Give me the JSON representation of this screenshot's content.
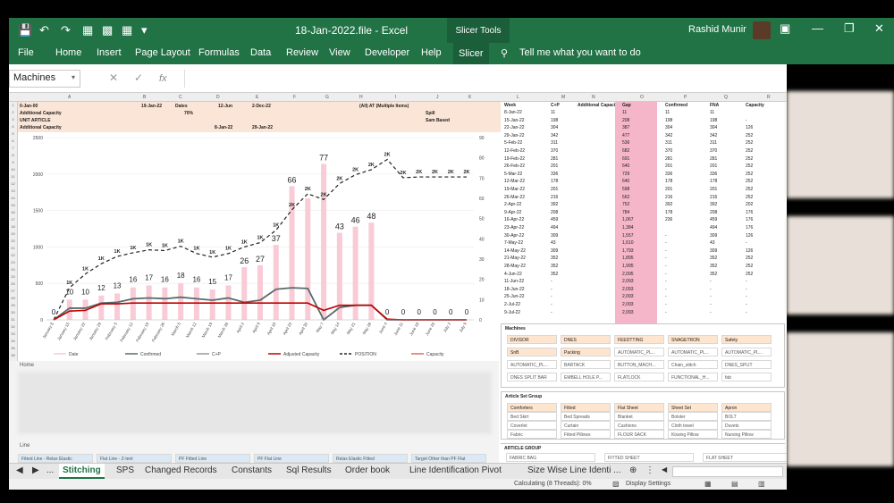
{
  "window": {
    "title": "18-Jan-2022.file  -  Excel",
    "context_tab": "Slicer Tools",
    "user": "Rashid Munir"
  },
  "ribbon_tabs": [
    "File",
    "Home",
    "Insert",
    "Page Layout",
    "Formulas",
    "Data",
    "Review",
    "View",
    "Developer",
    "Help",
    "Slicer"
  ],
  "tell_me": "Tell me what you want to do",
  "namebox": "Machines",
  "column_headers": [
    "A",
    "B",
    "C",
    "D",
    "E",
    "F",
    "G",
    "H",
    "I",
    "J",
    "K",
    "L",
    "M",
    "N",
    "O",
    "P",
    "Q",
    "R"
  ],
  "header_band": {
    "row1": [
      "0-Jan-00",
      "19-Jan-22",
      "Dates",
      "12-Jun",
      "2-Dec-22",
      "(All) AT (Multiple Items)"
    ],
    "row2": [
      "Additional Capacity",
      "70%",
      "Spill"
    ],
    "row3": [
      "UNIT ARTICLE",
      "Sam Based"
    ],
    "row4": [
      "Additional Capacity",
      "8-Jan-22",
      "29-Jan-22"
    ]
  },
  "chart_data": {
    "type": "line",
    "x": [
      "January 8",
      "January 15",
      "January 22",
      "January 29",
      "February 5",
      "February 12",
      "February 19",
      "February 26",
      "March 5",
      "March 12",
      "March 19",
      "March 26",
      "April 2",
      "April 9",
      "April 16",
      "April 23",
      "April 30",
      "May 7",
      "May 14",
      "May 21",
      "May 28",
      "June 4",
      "June 11",
      "June 18",
      "June 25",
      "July 2",
      "July 9"
    ],
    "y_left": [
      0,
      500,
      1000,
      1500,
      2000,
      2500
    ],
    "y_right": [
      0,
      10,
      20,
      30,
      40,
      50,
      60,
      70,
      80,
      90
    ],
    "bar_labels": [
      "0",
      "10",
      "10",
      "12",
      "13",
      "16",
      "17",
      "16",
      "18",
      "16",
      "15",
      "17",
      "26",
      "27",
      "37",
      "66",
      "",
      "77",
      "43",
      "46",
      "48",
      "0",
      "0",
      "0",
      "0",
      "0",
      "0"
    ],
    "bar_values": [
      0,
      10,
      10,
      12,
      13,
      16,
      17,
      16,
      18,
      16,
      15,
      17,
      26,
      27,
      37,
      66,
      60,
      77,
      43,
      46,
      48,
      0,
      0,
      0,
      0,
      0,
      0
    ],
    "position_labels": [
      "",
      "1K",
      "1K",
      "1K",
      "1K",
      "1K",
      "1K",
      "1K",
      "1K",
      "1K",
      "1K",
      "1K",
      "1K",
      "1K",
      "1K",
      "2K",
      "2K",
      "2K",
      "2K",
      "2K",
      "2K",
      "2K",
      "2K",
      "2K",
      "2K",
      "2K",
      "2K"
    ],
    "series": [
      {
        "name": "Date"
      },
      {
        "name": "Confirmed",
        "values": [
          0,
          160,
          160,
          230,
          240,
          290,
          300,
          290,
          310,
          290,
          270,
          300,
          240,
          270,
          420,
          440,
          430,
          0,
          170,
          200,
          200,
          0,
          0,
          0,
          0,
          0,
          0
        ]
      },
      {
        "name": "C+P"
      },
      {
        "name": "Adjusted Capacity",
        "values": [
          0,
          120,
          130,
          220,
          220,
          230,
          230,
          230,
          230,
          230,
          230,
          230,
          230,
          230,
          230,
          230,
          230,
          130,
          200,
          200,
          200,
          10,
          0,
          0,
          0,
          0,
          0
        ]
      },
      {
        "name": "POSITION",
        "values": [
          0,
          440,
          630,
          770,
          870,
          920,
          960,
          950,
          1010,
          910,
          860,
          910,
          1000,
          1060,
          1230,
          1510,
          1730,
          1650,
          1870,
          1990,
          2060,
          2200,
          1950,
          1960,
          1960,
          1960,
          1960
        ]
      },
      {
        "name": "Capacity"
      }
    ]
  },
  "table": {
    "headers": [
      "Week",
      "C+P",
      "Additional Capaci",
      "Gap",
      "Confirmed",
      "FNA",
      "Capacity"
    ],
    "rows": [
      [
        "8-Jan-22",
        "11",
        "",
        "11",
        "11",
        "11",
        ""
      ],
      [
        "15-Jan-22",
        "198",
        "",
        "208",
        "198",
        "198",
        "-"
      ],
      [
        "22-Jan-22",
        "304",
        "",
        "387",
        "304",
        "304",
        "126"
      ],
      [
        "29-Jan-22",
        "342",
        "",
        "477",
        "342",
        "342",
        "252"
      ],
      [
        "5-Feb-22",
        "311",
        "",
        "536",
        "311",
        "311",
        "252"
      ],
      [
        "12-Feb-22",
        "370",
        "",
        "682",
        "370",
        "370",
        "252"
      ],
      [
        "19-Feb-22",
        "281",
        "",
        "691",
        "281",
        "281",
        "252"
      ],
      [
        "26-Feb-22",
        "201",
        "",
        "640",
        "201",
        "201",
        "252"
      ],
      [
        "5-Mar-22",
        "336",
        "",
        "729",
        "336",
        "336",
        "252"
      ],
      [
        "12-Mar-22",
        "178",
        "",
        "640",
        "178",
        "178",
        "252"
      ],
      [
        "19-Mar-22",
        "201",
        "",
        "598",
        "201",
        "201",
        "252"
      ],
      [
        "26-Mar-22",
        "216",
        "",
        "562",
        "216",
        "216",
        "252"
      ],
      [
        "2-Apr-22",
        "392",
        "",
        "752",
        "392",
        "392",
        "202"
      ],
      [
        "9-Apr-22",
        "208",
        "",
        "784",
        "178",
        "208",
        "176"
      ],
      [
        "16-Apr-22",
        "459",
        "",
        "1,067",
        "236",
        "459",
        "176"
      ],
      [
        "23-Apr-22",
        "494",
        "",
        "1,384",
        "",
        "494",
        "176"
      ],
      [
        "30-Apr-22",
        "309",
        "",
        "1,557",
        "-",
        "309",
        "126"
      ],
      [
        "7-May-22",
        "43",
        "",
        "1,610",
        "-",
        "43",
        "-"
      ],
      [
        "14-May-22",
        "309",
        "",
        "1,793",
        "-",
        "309",
        "126"
      ],
      [
        "21-May-22",
        "352",
        "",
        "1,895",
        "-",
        "352",
        "252"
      ],
      [
        "28-May-22",
        "352",
        "",
        "1,995",
        "-",
        "352",
        "252"
      ],
      [
        "4-Jun-22",
        "352",
        "",
        "2,095",
        "-",
        "352",
        "252"
      ],
      [
        "11-Jun-22",
        "-",
        "",
        "2,093",
        "-",
        "-",
        "-"
      ],
      [
        "18-Jun-22",
        "-",
        "",
        "2,093",
        "-",
        "-",
        "-"
      ],
      [
        "25-Jun-22",
        "-",
        "",
        "2,093",
        "-",
        "-",
        "-"
      ],
      [
        "2-Jul-22",
        "-",
        "",
        "2,093",
        "-",
        "-",
        "-"
      ],
      [
        "9-Jul-22",
        "-",
        "",
        "2,093",
        "-",
        "-",
        "-"
      ]
    ]
  },
  "slicer_machines": {
    "title": "Machines",
    "items": [
      [
        "DIVISOR",
        "DNES",
        "FEEDTTING",
        "SNAGETRON",
        "Safety"
      ],
      [
        "SnB",
        "Packing",
        "AUTOMATIC_PL...",
        "AUTOMATIC_PL...",
        "AUTOMATIC_PL..."
      ],
      [
        "AUTOMATIC_PL...",
        "BARTACK",
        "BUTTON_MACH...",
        "Chain_stitch",
        "DNES_SPLIT"
      ],
      [
        "DNES SPLIT BAR",
        "EMBELL HOLE P...",
        "FLATLOCK",
        "FUNCTIONAL_H...",
        "fab"
      ]
    ]
  },
  "slicer_article": {
    "title": "Article Set Group",
    "items": [
      [
        "Comforters",
        "Fitted",
        "Flat Sheet",
        "Sheet Set",
        "Apron"
      ],
      [
        "Bed Skirt",
        "Bed Spreads",
        "Blanket",
        "Bolster",
        "BOLT"
      ],
      [
        "Coverlet",
        "Curtain",
        "Cushions",
        "Cloth towel",
        "Duvets"
      ],
      [
        "Fabric",
        "Fitted Pillows",
        "FLOUR SACK",
        "Kissing Pillow",
        "Nursing Pillow"
      ]
    ]
  },
  "article_group": {
    "title": "ARTICLE GROUP",
    "items": [
      "FABRIC BAG",
      "FITTED SHEET",
      "FLAT SHEET"
    ]
  },
  "panels": {
    "home": "Home",
    "line": "Line"
  },
  "line_items": [
    "Fitted Line - Relax Elastic",
    "Flat Line - Z-tent",
    "PF Fitted Line",
    "PF Flat Line",
    "Relax Elastic Fitted",
    "Target Other than PF Flat"
  ],
  "sheet_tabs": [
    "Stitching",
    "SPS",
    "Changed Records",
    "Constants",
    "Sql Results",
    "Order book",
    "Line Identification Pivot",
    "Size Wise Line Identi ..."
  ],
  "status": {
    "calc": "Calculating (8 Threads): 0%",
    "display": "Display Settings"
  },
  "colors": {
    "excel_green": "#217346",
    "position": "#222222",
    "confirmed": "#5a6b6b",
    "adjusted": "#c00000",
    "bars": "#f8cbd6",
    "gap": "#f4b6c8"
  }
}
